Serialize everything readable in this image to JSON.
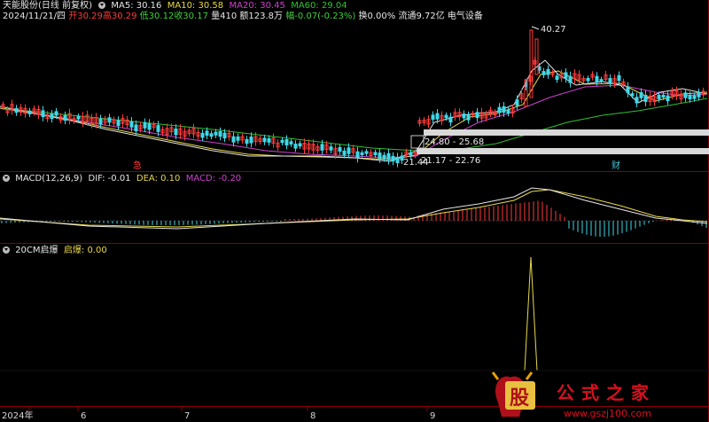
{
  "header_main": {
    "stock": "天能股份(日线 前复权)",
    "ma5": "MA5: 30.16",
    "ma10": "MA10: 30.58",
    "ma20": "MA20: 30.45",
    "ma60": "MA60: 29.04",
    "date": "2024/11/21/四",
    "open": "开30.29",
    "high": "高30.29",
    "low": "低30.12",
    "close": "收30.17",
    "vol": "量410",
    "amount": "额123.8万",
    "change": "幅-0.07(-0.23%)",
    "turnover": "换0.00%",
    "float": "流通9.72亿",
    "industry": "电气设备"
  },
  "annotations": {
    "peak": "40.27",
    "low": "21.44",
    "zone_upper": "24.80 - 25.68",
    "zone_lower": "21.17 - 22.76",
    "mark1": "急",
    "mark2": "财"
  },
  "header_macd": {
    "title": "MACD(12,26,9)",
    "dif": "DIF: -0.01",
    "dea": "DEA: 0.10",
    "macd": "MACD: -0.20"
  },
  "header_ind": {
    "title": "20CM启爆",
    "label": "启爆: 0.00"
  },
  "x_axis": [
    "2024年",
    "6",
    "7",
    "8",
    "9"
  ],
  "watermark": {
    "logo_char": "股",
    "site_name": "公式之家",
    "url": "www.gszj100.com"
  },
  "colors": {
    "up": "#ff3a3a",
    "down": "#40d8e8",
    "ma5": "#e6e6e6",
    "ma10": "#e8d84a",
    "ma20": "#d040d0",
    "ma60": "#30c030"
  }
}
